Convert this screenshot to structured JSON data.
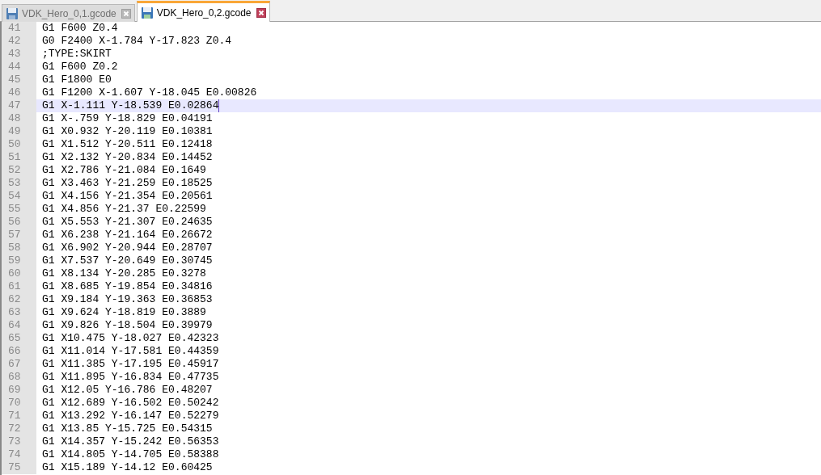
{
  "tabs": [
    {
      "label": "VDK_Hero_0,1.gcode",
      "selected": false
    },
    {
      "label": "VDK_Hero_0,2.gcode",
      "selected": true
    }
  ],
  "editor": {
    "lines": [
      {
        "number": "41",
        "text": "G1 F600 Z0.4",
        "current": false
      },
      {
        "number": "42",
        "text": "G0 F2400 X-1.784 Y-17.823 Z0.4",
        "current": false
      },
      {
        "number": "43",
        "text": ";TYPE:SKIRT",
        "current": false
      },
      {
        "number": "44",
        "text": "G1 F600 Z0.2",
        "current": false
      },
      {
        "number": "45",
        "text": "G1 F1800 E0",
        "current": false
      },
      {
        "number": "46",
        "text": "G1 F1200 X-1.607 Y-18.045 E0.00826",
        "current": false
      },
      {
        "number": "47",
        "text": "G1 X-1.111 Y-18.539 E0.02864",
        "current": true
      },
      {
        "number": "48",
        "text": "G1 X-.759 Y-18.829 E0.04191",
        "current": false
      },
      {
        "number": "49",
        "text": "G1 X0.932 Y-20.119 E0.10381",
        "current": false
      },
      {
        "number": "50",
        "text": "G1 X1.512 Y-20.511 E0.12418",
        "current": false
      },
      {
        "number": "51",
        "text": "G1 X2.132 Y-20.834 E0.14452",
        "current": false
      },
      {
        "number": "52",
        "text": "G1 X2.786 Y-21.084 E0.1649",
        "current": false
      },
      {
        "number": "53",
        "text": "G1 X3.463 Y-21.259 E0.18525",
        "current": false
      },
      {
        "number": "54",
        "text": "G1 X4.156 Y-21.354 E0.20561",
        "current": false
      },
      {
        "number": "55",
        "text": "G1 X4.856 Y-21.37 E0.22599",
        "current": false
      },
      {
        "number": "56",
        "text": "G1 X5.553 Y-21.307 E0.24635",
        "current": false
      },
      {
        "number": "57",
        "text": "G1 X6.238 Y-21.164 E0.26672",
        "current": false
      },
      {
        "number": "58",
        "text": "G1 X6.902 Y-20.944 E0.28707",
        "current": false
      },
      {
        "number": "59",
        "text": "G1 X7.537 Y-20.649 E0.30745",
        "current": false
      },
      {
        "number": "60",
        "text": "G1 X8.134 Y-20.285 E0.3278",
        "current": false
      },
      {
        "number": "61",
        "text": "G1 X8.685 Y-19.854 E0.34816",
        "current": false
      },
      {
        "number": "62",
        "text": "G1 X9.184 Y-19.363 E0.36853",
        "current": false
      },
      {
        "number": "63",
        "text": "G1 X9.624 Y-18.819 E0.3889",
        "current": false
      },
      {
        "number": "64",
        "text": "G1 X9.826 Y-18.504 E0.39979",
        "current": false
      },
      {
        "number": "65",
        "text": "G1 X10.475 Y-18.027 E0.42323",
        "current": false
      },
      {
        "number": "66",
        "text": "G1 X11.014 Y-17.581 E0.44359",
        "current": false
      },
      {
        "number": "67",
        "text": "G1 X11.385 Y-17.195 E0.45917",
        "current": false
      },
      {
        "number": "68",
        "text": "G1 X11.895 Y-16.834 E0.47735",
        "current": false
      },
      {
        "number": "69",
        "text": "G1 X12.05 Y-16.786 E0.48207",
        "current": false
      },
      {
        "number": "70",
        "text": "G1 X12.689 Y-16.502 E0.50242",
        "current": false
      },
      {
        "number": "71",
        "text": "G1 X13.292 Y-16.147 E0.52279",
        "current": false
      },
      {
        "number": "72",
        "text": "G1 X13.85 Y-15.725 E0.54315",
        "current": false
      },
      {
        "number": "73",
        "text": "G1 X14.357 Y-15.242 E0.56353",
        "current": false
      },
      {
        "number": "74",
        "text": "G1 X14.805 Y-14.705 E0.58388",
        "current": false
      },
      {
        "number": "75",
        "text": "G1 X15.189 Y-14.12 E0.60425",
        "current": false
      }
    ]
  }
}
